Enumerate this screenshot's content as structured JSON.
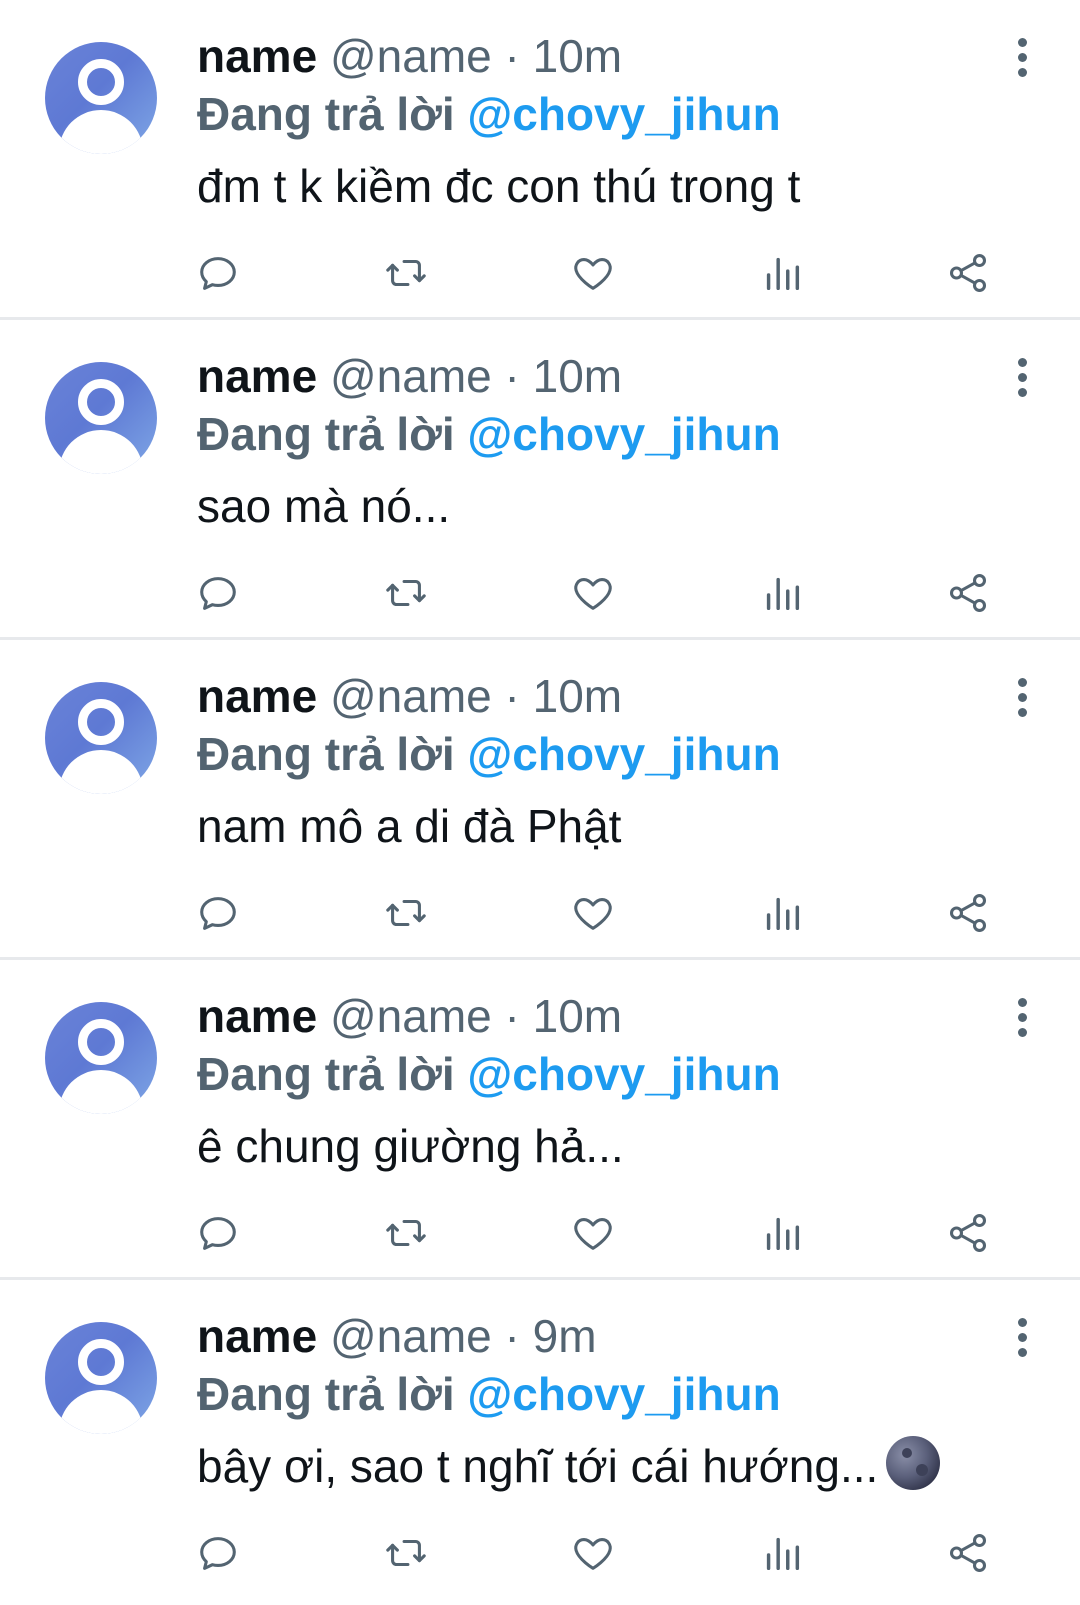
{
  "colors": {
    "text": "#0f1419",
    "secondary": "#536471",
    "link": "#1d9bf0",
    "divider": "#e7e9ec"
  },
  "icons": {
    "more": "more-vertical-icon",
    "reply": "reply-bubble-icon",
    "retweet": "retweet-icon",
    "like": "heart-icon",
    "views": "views-chart-icon",
    "share": "share-icon"
  },
  "tweets": [
    {
      "display_name": "name",
      "handle": "@name",
      "separator": "·",
      "time": "10m",
      "reply_prefix": "Đang trả lời",
      "reply_target": "@chovy_jihun",
      "text": "đm t k kiềm đc con thú trong t"
    },
    {
      "display_name": "name",
      "handle": "@name",
      "separator": "·",
      "time": "10m",
      "reply_prefix": "Đang trả lời",
      "reply_target": "@chovy_jihun",
      "text": "sao mà nó..."
    },
    {
      "display_name": "name",
      "handle": "@name",
      "separator": "·",
      "time": "10m",
      "reply_prefix": "Đang trả lời",
      "reply_target": "@chovy_jihun",
      "text": "nam mô a di đà Phật"
    },
    {
      "display_name": "name",
      "handle": "@name",
      "separator": "·",
      "time": "10m",
      "reply_prefix": "Đang trả lời",
      "reply_target": "@chovy_jihun",
      "text": "ê chung giường hả..."
    },
    {
      "display_name": "name",
      "handle": "@name",
      "separator": "·",
      "time": "9m",
      "reply_prefix": "Đang trả lời",
      "reply_target": "@chovy_jihun",
      "text": "bây ơi, sao t nghĩ tới cái hướng...",
      "emoji": "new-moon-face-emoji"
    }
  ]
}
